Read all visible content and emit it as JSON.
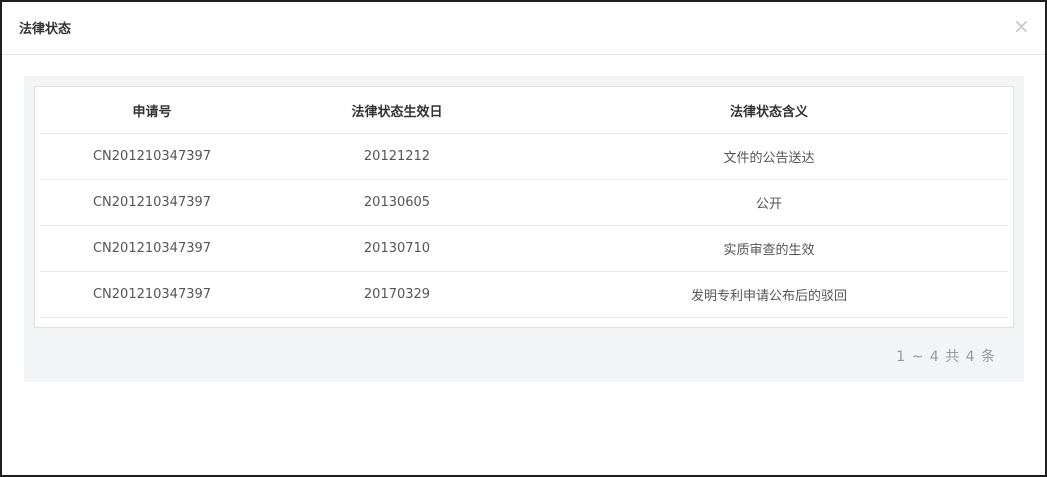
{
  "dialog": {
    "title": "法律状态",
    "close_symbol": "×"
  },
  "table": {
    "columns": [
      "申请号",
      "法律状态生效日",
      "法律状态含义"
    ],
    "rows": [
      [
        "CN201210347397",
        "20121212",
        "文件的公告送达"
      ],
      [
        "CN201210347397",
        "20130605",
        "公开"
      ],
      [
        "CN201210347397",
        "20130710",
        "实质审查的生效"
      ],
      [
        "CN201210347397",
        "20170329",
        "发明专利申请公布后的驳回"
      ]
    ]
  },
  "pagination": {
    "summary": "1 ~ 4 共 4 条"
  }
}
